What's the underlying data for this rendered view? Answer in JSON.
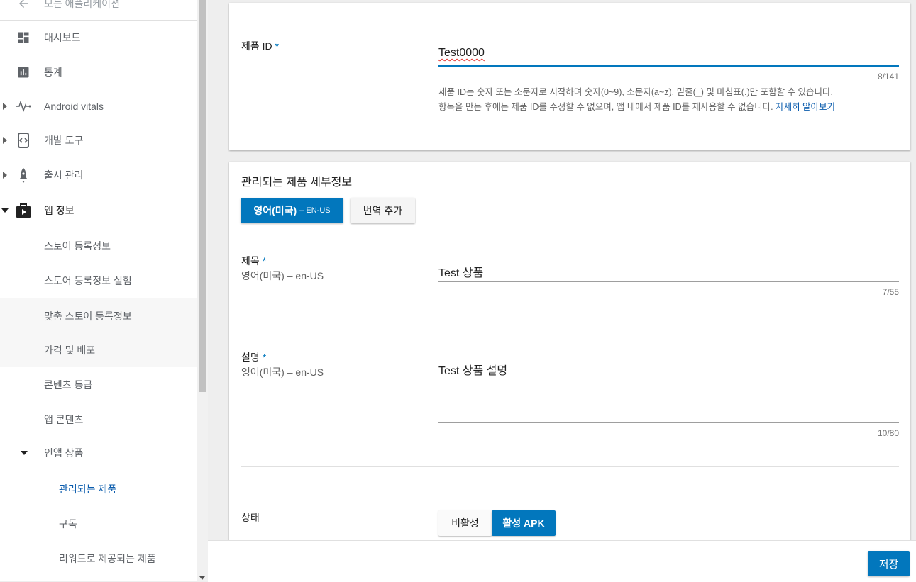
{
  "sidebar": {
    "back_label": "모든 애플리케이션",
    "items": [
      {
        "label": "대시보드",
        "icon": "dashboard-icon"
      },
      {
        "label": "통계",
        "icon": "bar-chart-icon"
      },
      {
        "label": "Android vitals",
        "icon": "pulse-icon"
      },
      {
        "label": "개발 도구",
        "icon": "dev-tools-icon"
      },
      {
        "label": "출시 관리",
        "icon": "rocket-icon"
      },
      {
        "label": "앱 정보",
        "icon": "play-store-icon"
      }
    ],
    "sub_items": [
      {
        "label": "스토어 등록정보"
      },
      {
        "label": "스토어 등록정보 실험"
      },
      {
        "label": "맞춤 스토어 등록정보"
      },
      {
        "label": "가격 및 배포"
      },
      {
        "label": "콘텐츠 등급"
      },
      {
        "label": "앱 콘텐츠"
      },
      {
        "label": "인앱 상품"
      }
    ],
    "iap_items": [
      {
        "label": "관리되는 제품"
      },
      {
        "label": "구독"
      },
      {
        "label": "리워드로 제공되는 제품"
      }
    ]
  },
  "product_id": {
    "label": "제품 ID",
    "required": "*",
    "value": "Test0000",
    "counter": "8/141",
    "help_line1": "제품 ID는 숫자 또는 소문자로 시작하며 숫자(0~9), 소문자(a~z), 밑줄(_) 및 마침표(.)만 포함할 수 있습니다.",
    "help_line2": "항목을 만든 후에는 제품 ID를 수정할 수 없으며, 앱 내에서 제품 ID를 재사용할 수 없습니다.",
    "help_link": "자세히 알아보기"
  },
  "details": {
    "heading": "관리되는 제품 세부정보",
    "lang_tab_main": "영어(미국)",
    "lang_tab_code": "– EN-US",
    "add_translation": "번역 추가",
    "title": {
      "label": "제목",
      "required": "*",
      "sub": "영어(미국) – en-US",
      "value": "Test 상품",
      "counter": "7/55"
    },
    "description": {
      "label": "설명",
      "required": "*",
      "sub": "영어(미국) – en-US",
      "value": "Test 상품 설명",
      "counter": "10/80"
    },
    "status": {
      "label": "상태",
      "inactive": "비활성",
      "active": "활성 APK"
    }
  },
  "footer": {
    "save": "저장"
  },
  "colors": {
    "accent": "#0277bd"
  }
}
